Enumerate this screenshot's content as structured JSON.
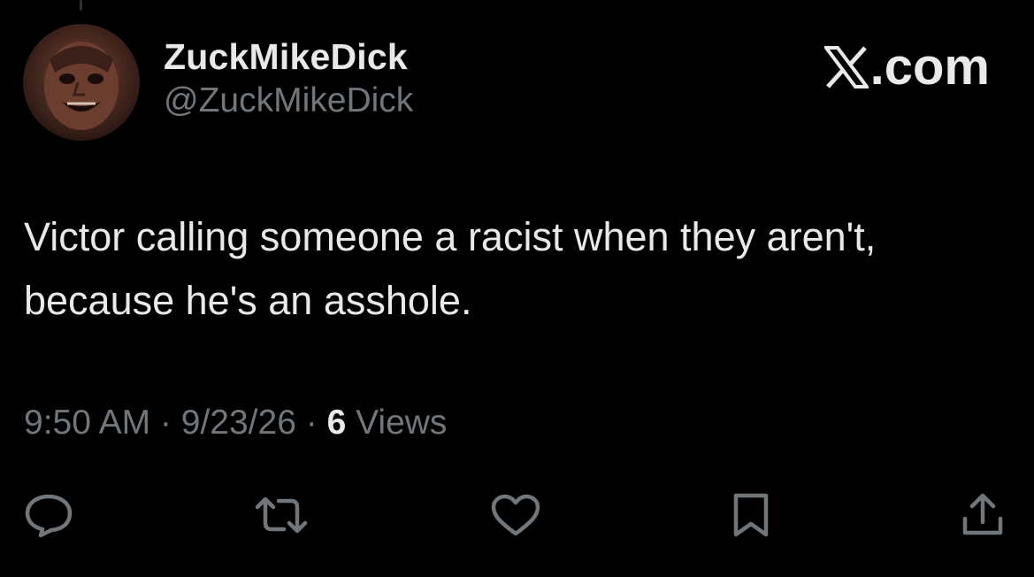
{
  "user": {
    "display_name": "ZuckMikeDick",
    "handle": "@ZuckMikeDick"
  },
  "brand": {
    "logo_icon": "x-logo-icon",
    "suffix": ".com"
  },
  "tweet": {
    "text": "Victor calling someone a racist when they aren't, because he's an asshole."
  },
  "meta": {
    "time": "9:50 AM",
    "separator": " · ",
    "date": "9/23/26",
    "views_count": "6",
    "views_label": "Views"
  },
  "actions": [
    {
      "name": "reply-icon"
    },
    {
      "name": "repost-icon"
    },
    {
      "name": "like-icon"
    },
    {
      "name": "bookmark-icon"
    },
    {
      "name": "share-icon"
    }
  ],
  "colors": {
    "background": "#000000",
    "primary_text": "#e7e9ea",
    "secondary_text": "#71767b"
  }
}
